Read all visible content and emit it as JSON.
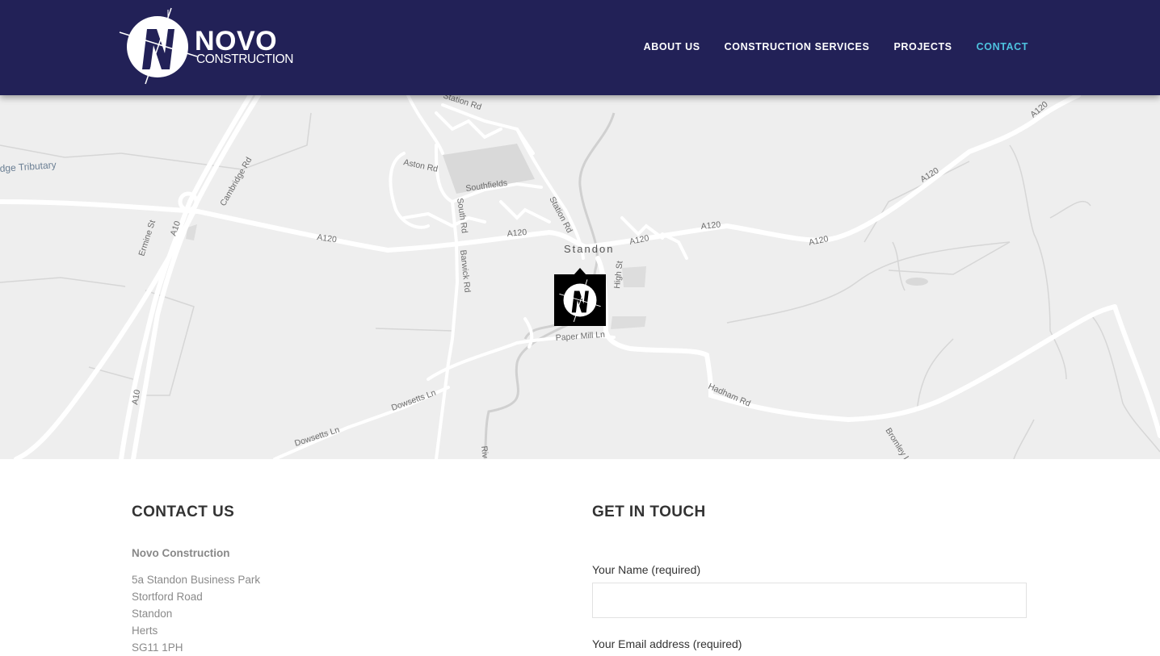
{
  "header": {
    "logo": {
      "word": "NOVO",
      "sub": "CONSTRUCTION"
    },
    "nav": [
      {
        "label": "ABOUT US",
        "active": false
      },
      {
        "label": "CONSTRUCTION SERVICES",
        "active": false
      },
      {
        "label": "PROJECTS",
        "active": false
      },
      {
        "label": "CONTACT",
        "active": true
      }
    ],
    "colors": {
      "background": "#222157",
      "active": "#4ec3df"
    }
  },
  "map": {
    "labels": {
      "tributary": "dge Tributary",
      "cambridge_rd": "Cambridge Rd",
      "ermine_st": "Ermine St",
      "a10_top": "A10",
      "a10_bottom": "A10",
      "a120_1": "A120",
      "a120_2": "A120",
      "a120_3": "A120",
      "a120_4": "A120",
      "a120_5": "A120",
      "a120_6": "A120",
      "a120_7": "A120",
      "aston_rd": "Aston Rd",
      "southfields": "Southfields",
      "south_rd": "South Rd",
      "station_rd": "Station Rd",
      "station_rd_top": "Station Rd",
      "standon": "Standon",
      "high_st": "High St",
      "barwick_rd": "Barwick Rd",
      "paper_mill_ln": "Paper Mill Ln",
      "hadham_rd": "Hadham Rd",
      "dowsetts_ln_1": "Dowsetts Ln",
      "dowsetts_ln_2": "Dowsetts Ln",
      "bromley": "Bromley L",
      "river": "Riv"
    },
    "marker_icon": "novo-logo-icon"
  },
  "contact": {
    "heading": "CONTACT US",
    "company": "Novo Construction",
    "address": [
      "5a Standon Business Park",
      "Stortford Road",
      "Standon",
      "Herts",
      "SG11 1PH"
    ]
  },
  "form": {
    "heading": "GET IN TOUCH",
    "name_label": "Your Name (required)",
    "email_label": "Your Email address (required)"
  }
}
